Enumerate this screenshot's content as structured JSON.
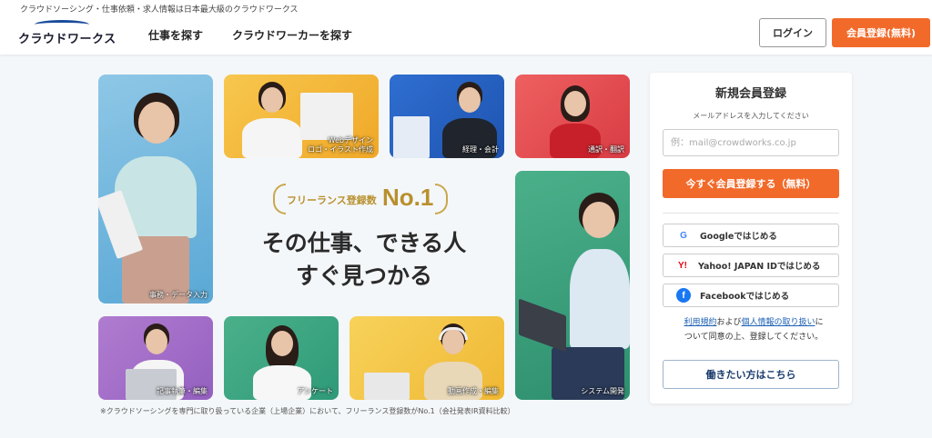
{
  "header": {
    "tagline": "クラウドソーシング・仕事依頼・求人情報は日本最大級のクラウドワークス",
    "logo_text": "クラウドワークス",
    "nav": [
      "仕事を探す",
      "クラウドワーカーを探す"
    ],
    "login_label": "ログイン",
    "register_label": "会員登録(無料)"
  },
  "tiles": {
    "office": "事務・データ入力",
    "webdesign_line1": "Webデザイン",
    "webdesign_line2": "ロゴ・イラスト作成",
    "accounting": "経理・会計",
    "translation": "通訳・翻訳",
    "system": "システム開発",
    "writing": "記事執筆・編集",
    "survey": "アンケート",
    "video": "動画作成・編集"
  },
  "hero": {
    "badge_text": "フリーランス登録数",
    "badge_rank": "No.1",
    "headline_line1": "その仕事、できる人",
    "headline_line2": "すぐ見つかる",
    "footnote": "※クラウドソーシングを専門に取り扱っている企業（上場企業）において、フリーランス登録数がNo.1（会社発表IR資料比較）"
  },
  "signup": {
    "title": "新規会員登録",
    "subtitle": "メールアドレスを入力してください",
    "email_placeholder": "例：mail@crowdworks.co.jp",
    "submit_label": "今すぐ会員登録する（無料）",
    "google_label": "Googleではじめる",
    "yahoo_label": "Yahoo! JAPAN IDではじめる",
    "facebook_label": "Facebookではじめる",
    "terms_link": "利用規約",
    "terms_and": "および",
    "privacy_link": "個人情報の取り扱い",
    "terms_suffix": "に",
    "terms_line2": "ついて同意の上、登録してください。",
    "worker_label": "働きたい方はこちら"
  },
  "colors": {
    "accent": "#f26a2a",
    "brand": "#1a4c9c",
    "gold": "#b8902e"
  }
}
